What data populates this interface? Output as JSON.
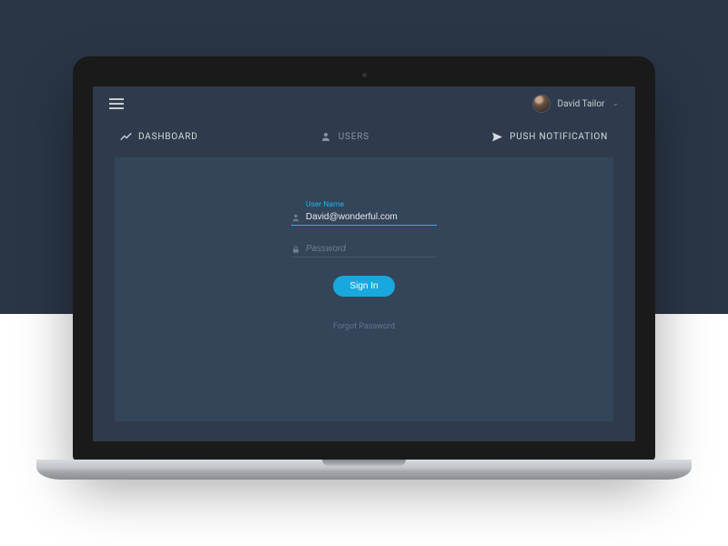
{
  "user": {
    "name": "David Tailor"
  },
  "nav": {
    "dashboard": "DASHBOARD",
    "users": "USERS",
    "push": "PUSH NOTIFICATION"
  },
  "form": {
    "username_label": "User Name",
    "username_value": "David@wonderful.com",
    "password_placeholder": "Password",
    "signin_label": "Sign In",
    "forgot_label": "Forgot Password"
  }
}
